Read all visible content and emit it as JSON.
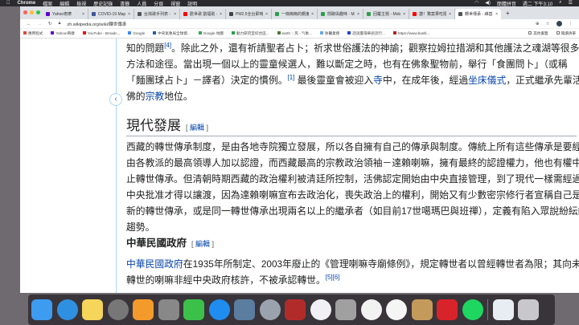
{
  "menubar": {
    "items": [
      "Chrome",
      "檔案",
      "編輯",
      "檢視",
      "歷史記錄",
      "書籤",
      "人員",
      "分頁",
      "視窗",
      "說明"
    ],
    "input_method": "簡體拼音",
    "clock": "週二 下午3:10"
  },
  "tabs": [
    {
      "label": "Yahoo奇摩",
      "color": "#6001d2"
    },
    {
      "label": "COVID-19 Map -",
      "color": "#3b5998"
    },
    {
      "label": "台灣歌手列表 - 維",
      "color": "#555555"
    },
    {
      "label": "歡世歌 劉福助 - Yo",
      "color": "#ff0000"
    },
    {
      "label": "PM2.5全台即時IR",
      "color": "#444444"
    },
    {
      "label": "一條簡簡的鋼鬼 -",
      "color": "#2e9e4e"
    },
    {
      "label": "閒聊與趣味 - Mob",
      "color": "#2e9e4e"
    },
    {
      "label": "回覆主題 - Mobile",
      "color": "#2e9e4e"
    },
    {
      "label": "讚！驚案果吃隨",
      "color": "#ff0000"
    },
    {
      "label": "轉世傳承 - 維基百",
      "color": "#555555",
      "active": true
    }
  ],
  "address": {
    "url": "zh.wikipedia.org/wiki/轉世傳承"
  },
  "bookmarks": [
    {
      "label": "應用程式",
      "color": "#e94235"
    },
    {
      "label": "Yahoo!奇摩",
      "color": "#6001d2"
    },
    {
      "label": "YouTube - Broadc...",
      "color": "#ff0000"
    },
    {
      "label": "Google",
      "color": "#4285f4"
    },
    {
      "label": "中央氣象局全球資...",
      "color": "#2a5caa"
    },
    {
      "label": "Google 地圖",
      "color": "#34a853"
    },
    {
      "label": "動力研究室綜合區...",
      "color": "#2e9e4e"
    },
    {
      "label": "earth :: 风 - 气象...",
      "color": "#4a7a3a"
    },
    {
      "label": "防醫業務",
      "color": "#66aadd"
    },
    {
      "label": "話說臺灣華語流行...",
      "color": "#2244cc"
    },
    {
      "label": "https://www.bastil...",
      "color": "#b22222"
    }
  ],
  "bookmarks_right": {
    "other": "其他書籤",
    "reading": "閱讀清單"
  },
  "article": {
    "p1": {
      "l1a": "知的問題",
      "ref4": "[4]",
      "l1b": "。除此之外，還有祈請聖者占卜；祈求世俗護法的神諭；觀察拉姆拉措湖和其他護法之魂湖等很多",
      "l2": "方法和途徑。當出現一個以上的靈童候選人，難以斷定之時，也有在佛象聖物前，舉行「食團問卜」（或稱",
      "l3a": "「麵團球占卜」－譯者）決定的慣例。",
      "ref1": "[1]",
      "l3b": " 最後靈童會被迎入",
      "link_temple": "寺",
      "l3c": "中，在成年後，經過",
      "link_ceremony": "坐床儀式",
      "l3d": "，正式繼承先輩活",
      "l4a": "佛的",
      "link_religion": "宗教",
      "l4b": "地位。"
    },
    "h2": "現代發展",
    "edit": "編輯",
    "p2": [
      "西藏的轉世傳承制度，是由各地寺院獨立發展，所以各自擁有自己的傳承與制度。傳統上所有這些傳承是要經",
      "由各教派的最高領導人加以認證，而西藏最高的宗教政治領袖－達賴喇嘛，擁有最終的認證權力，他也有權中",
      "止轉世傳承。但清朝時期西藏的政治權利被清廷所控制，活佛認定開始由中央直接管理，到了現代一樣需經過",
      "中央批准才得以讓渡，因為達賴喇嘛宣布去政治化，喪失政治上的權利，開始又有少數密宗修行者宣稱自己是",
      "新的轉世傳承，或是同一轉世傳承出現兩名以上的繼承者（如目前17世噶瑪巴與班禪），定義有陷入眾說紛紜的",
      "趨勢。"
    ],
    "h3": "中華民國政府",
    "p3": {
      "link_roc": "中華民國政府",
      "l1": "在1935年所制定、2003年廢止的《管理喇嘛寺廟條例》，規定轉世者以曾經轉世者為限；其向未",
      "l2": "轉世的喇嘛非經中央政府核許，不被承認轉世。",
      "ref5": "[5]",
      "ref6": "[6]"
    }
  },
  "dock": [
    {
      "name": "finder",
      "color": "#3d9bf0"
    },
    {
      "name": "safari",
      "color": "#2f8fe0"
    },
    {
      "name": "notes",
      "color": "#f5d55a"
    },
    {
      "name": "launchpad",
      "color": "#777"
    },
    {
      "name": "pages",
      "color": "#f39a2c"
    },
    {
      "name": "system-preferences",
      "color": "#888"
    },
    {
      "name": "facetime",
      "color": "#3bc14a"
    },
    {
      "name": "app-store",
      "color": "#1f8cf0"
    },
    {
      "name": "iphoto",
      "color": "#5a7da0"
    },
    {
      "name": "google-earth-pro",
      "color": "#9aa3ad"
    },
    {
      "name": "photo-booth",
      "color": "#b22b2b"
    },
    {
      "name": "itunes",
      "color": "#f0f0f5"
    },
    {
      "name": "disk-utility",
      "color": "#a0a0a0"
    },
    {
      "name": "chrome",
      "color": "#f2f2f2"
    },
    {
      "name": "photos",
      "color": "#f5f5f5"
    },
    {
      "name": "paintbrush",
      "color": "#c49a5a"
    },
    {
      "name": "pdf-expert",
      "color": "#d9232a"
    },
    {
      "name": "spotify",
      "color": "#1ed760"
    },
    {
      "name": "downloads-stack",
      "color": "#e8edf3"
    },
    {
      "name": "trash",
      "color": "#c8c8cc"
    }
  ]
}
